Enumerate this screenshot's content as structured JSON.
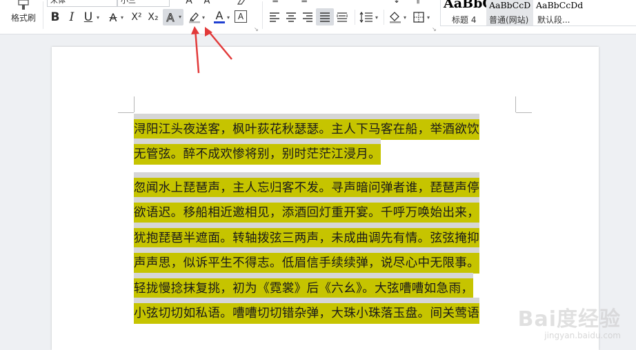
{
  "ribbon": {
    "font_name": "宋体",
    "font_size": "小三",
    "format_painter_label": "格式刷",
    "styles": [
      {
        "sample": "AaBbC",
        "name": "标题 4"
      },
      {
        "sample": "AaBbCcD",
        "name": "普通(网站)"
      },
      {
        "sample": "AaBbCcDd",
        "name": "默认段..."
      }
    ],
    "buttons": {
      "bold": "B",
      "italic": "I",
      "underline": "U",
      "strikethrough": "A",
      "superscript": "X²",
      "subscript": "X₂",
      "text_effect": "A",
      "font_color": "A",
      "char_border": "A"
    }
  },
  "document": {
    "paragraphs": [
      [
        "浔阳江头夜送客，枫叶荻花秋瑟瑟。主人下马客在船，举酒欲饮",
        "无管弦。醉不成欢惨将别，别时茫茫江浸月。"
      ],
      [
        "忽闻水上琵琶声，主人忘归客不发。寻声暗问弹者谁，琵琶声停",
        "欲语迟。移船相近邀相见，添酒回灯重开宴。千呼万唤始出来，",
        "犹抱琵琶半遮面。转轴拨弦三两声，未成曲调先有情。弦弦掩抑",
        "声声思，似诉平生不得志。低眉信手续续弹，说尽心中无限事。",
        "轻拢慢捻抹复挑，初为《霓裳》后《六幺》。大弦嘈嘈如急雨，",
        "小弦切切如私语。嘈嘈切切错杂弹，大珠小珠落玉盘。间关莺语"
      ]
    ]
  },
  "watermark": {
    "brand": "Bai度经验",
    "url": "jingyan.baidu.com"
  },
  "colors": {
    "highlight": "#c6c400",
    "arrow": "#e23a3a",
    "font_color_bar": "#1f3fd1"
  }
}
